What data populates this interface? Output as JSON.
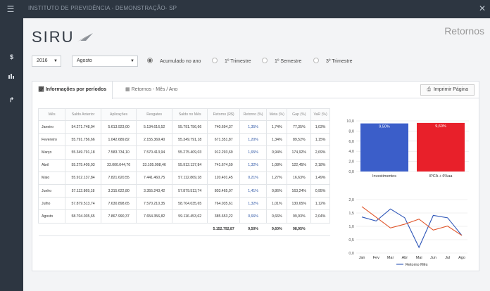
{
  "window": {
    "title": "INSTITUTO DE PREVIDÊNCIA - DEMONSTRAÇÃO- SP"
  },
  "app": {
    "logo": "SIRU",
    "page_title": "Retornos"
  },
  "filters": {
    "year": "2016",
    "month": "Agosto",
    "options": [
      {
        "label": "Acumulado no ano",
        "selected": true
      },
      {
        "label": "1º Trimestre",
        "selected": false
      },
      {
        "label": "1º Semestre",
        "selected": false
      },
      {
        "label": "3º Trimestre",
        "selected": false
      }
    ]
  },
  "tabs": [
    {
      "label": "Informações por períodos",
      "active": true
    },
    {
      "label": "Retornos - Mês / Ano",
      "active": false
    }
  ],
  "print_label": "Imprimir Página",
  "table": {
    "headers": [
      "Mês",
      "Saldo Anterior",
      "Aplicações",
      "Resgates",
      "Saldo no Mês",
      "Retorno (R$)",
      "Retorno (%)",
      "Meta (%)",
      "Gap (%)",
      "VaR (%)"
    ],
    "rows": [
      [
        "Janeiro",
        "54.271.748,04",
        "5.613.923,00",
        "5.134.616,52",
        "55.791.756,66",
        "740.694,37",
        "1,35%",
        "1,74%",
        "77,35%",
        "1,03%"
      ],
      [
        "Fevereiro",
        "55.791.756,66",
        "1.042.689,82",
        "2.155.369,40",
        "55.349.791,18",
        "671.351,87",
        "1,20%",
        "1,34%",
        "89,52%",
        "1,15%"
      ],
      [
        "Março",
        "55.349.791,18",
        "7.583.734,10",
        "7.570.413,94",
        "55.275.409,03",
        "912.293,69",
        "1,65%",
        "0,94%",
        "174,92%",
        "2,69%"
      ],
      [
        "Abril",
        "55.275.409,03",
        "33.000.044,76",
        "33.105.998,46",
        "55.912.137,84",
        "741.674,59",
        "1,32%",
        "1,08%",
        "122,45%",
        "2,18%"
      ],
      [
        "Maio",
        "55.912.137,84",
        "7.821.620,55",
        "7.441.460,75",
        "57.112.869,18",
        "120.401,45",
        "0,21%",
        "1,27%",
        "16,63%",
        "1,49%"
      ],
      [
        "Junho",
        "57.112.869,18",
        "3.315.622,80",
        "3.355.243,42",
        "57.879.513,74",
        "803.465,07",
        "1,41%",
        "0,86%",
        "163,24%",
        "0,95%"
      ],
      [
        "Julho",
        "57.879.513,74",
        "7.630.898,65",
        "7.570.210,35",
        "58.704.035,65",
        "764.035,61",
        "1,32%",
        "1,01%",
        "130,65%",
        "1,12%"
      ],
      [
        "Agosto",
        "58.704.035,65",
        "7.867.990,37",
        "7.654.356,82",
        "59.116.453,62",
        "385.653,22",
        "0,66%",
        "0,66%",
        "99,93%",
        "2,04%"
      ]
    ],
    "totals": [
      "",
      "",
      "",
      "",
      "",
      "5.152.792,87",
      "9,50%",
      "9,60%",
      "98,95%",
      ""
    ]
  },
  "chart_data": [
    {
      "type": "bar",
      "categories": [
        "Investimentos",
        "IPCA + 6%aa"
      ],
      "values": [
        9.5,
        9.6
      ],
      "data_labels": [
        "9,50%",
        "9,60%"
      ],
      "colors": [
        "#3b5ec9",
        "#e8202a"
      ],
      "ylim": [
        0,
        10
      ],
      "yticks": [
        "0,0",
        "2,0",
        "4,0",
        "6,0",
        "8,0",
        "10,0"
      ],
      "grid": true
    },
    {
      "type": "line",
      "categories": [
        "Jan",
        "Fev",
        "Mar",
        "Abr",
        "Mai",
        "Jun",
        "Jul",
        "Ago"
      ],
      "series": [
        {
          "name": "Retorno Mês",
          "values": [
            1.35,
            1.2,
            1.65,
            1.32,
            0.21,
            1.41,
            1.32,
            0.66
          ],
          "color": "#2e56b8"
        },
        {
          "name": "",
          "values": [
            1.74,
            1.34,
            0.94,
            1.08,
            1.27,
            0.86,
            1.01,
            0.66
          ],
          "color": "#e0552a"
        }
      ],
      "ylim": [
        0,
        2
      ],
      "yticks": [
        "0,0",
        "0,5",
        "1,0",
        "1,5",
        "2,0"
      ],
      "legend": "bottom",
      "grid": true
    }
  ],
  "icons": {
    "menu": "menu-icon",
    "dollar": "dollar-icon",
    "chart": "bar-chart-icon",
    "share": "share-icon",
    "close": "close-icon",
    "print": "print-icon"
  }
}
